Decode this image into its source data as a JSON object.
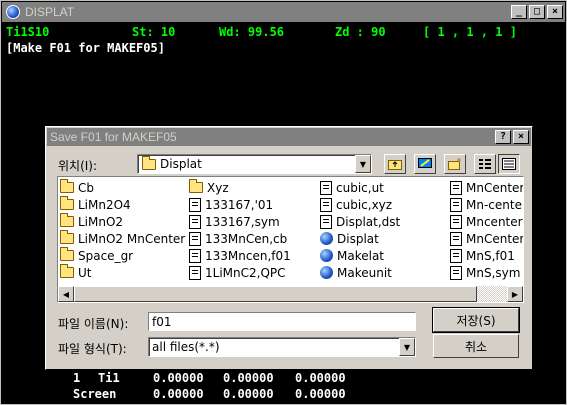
{
  "window": {
    "title": "DISPLAT",
    "min_label": "_",
    "max_label": "□",
    "close_label": "×"
  },
  "console": {
    "status_line": {
      "name": "Ti1S10",
      "st": "St: 10",
      "wd": "Wd: 99.56",
      "zd": "Zd : 90",
      "coords": "[ 1 , 1 , 1 ]"
    },
    "prompt": "[Make F01 for MAKEF05]",
    "rows": [
      {
        "idx": "1",
        "label": "Ti1",
        "v1": "0.00000",
        "v2": "0.00000",
        "v3": "0.00000"
      },
      {
        "idx": "",
        "label": "Screen",
        "v1": "0.00000",
        "v2": "0.00000",
        "v3": "0.00000"
      }
    ]
  },
  "dialog": {
    "title": "Save F01 for MAKEF05",
    "help_label": "?",
    "close_label": "×",
    "location_label": "위치(I):",
    "location_value": "Displat",
    "file_columns": [
      [
        {
          "name": "Cb",
          "type": "folder"
        },
        {
          "name": "LiMn2O4",
          "type": "folder"
        },
        {
          "name": "LiMnO2",
          "type": "folder"
        },
        {
          "name": "LiMnO2 MnCenter",
          "type": "folder"
        },
        {
          "name": "Space_gr",
          "type": "folder"
        },
        {
          "name": "Ut",
          "type": "folder"
        }
      ],
      [
        {
          "name": "Xyz",
          "type": "folder"
        },
        {
          "name": "133167,'01",
          "type": "file"
        },
        {
          "name": "133167,sym",
          "type": "file"
        },
        {
          "name": "133MnCen,cb",
          "type": "file"
        },
        {
          "name": "133Mncen,f01",
          "type": "file"
        },
        {
          "name": "1LiMnC2,QPC",
          "type": "file"
        }
      ],
      [
        {
          "name": "cubic,ut",
          "type": "file"
        },
        {
          "name": "cubic,xyz",
          "type": "file"
        },
        {
          "name": "Displat,dst",
          "type": "file"
        },
        {
          "name": "Displat",
          "type": "exe"
        },
        {
          "name": "Makelat",
          "type": "exe"
        },
        {
          "name": "Makeunit",
          "type": "exe"
        }
      ],
      [
        {
          "name": "MnCenter,",
          "type": "file"
        },
        {
          "name": "Mn-center",
          "type": "file"
        },
        {
          "name": "Mncenter,",
          "type": "file"
        },
        {
          "name": "MnCenter,",
          "type": "file"
        },
        {
          "name": "MnS,f01",
          "type": "file"
        },
        {
          "name": "MnS,sym",
          "type": "file"
        }
      ]
    ],
    "filename_label": "파일 이름(N):",
    "filename_value": "f01",
    "filetype_label": "파일 형식(T):",
    "filetype_value": "all files(*.*)",
    "save_label": "저장(S)",
    "cancel_label": "취소"
  },
  "colors": {
    "console_green": "#00ff00",
    "console_white": "#ffffff",
    "dialog_face": "#d4d0c8",
    "inactive_title": "#808080"
  }
}
